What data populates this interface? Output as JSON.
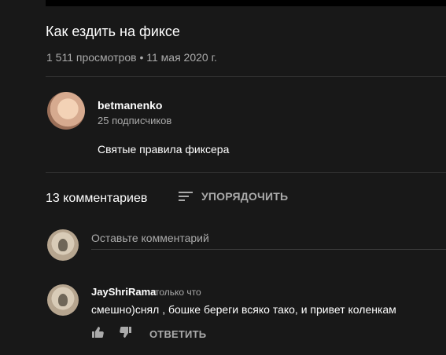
{
  "video": {
    "title": "Как ездить на фиксе",
    "meta": "1 511 просмотров • 11 мая 2020 г."
  },
  "channel": {
    "name": "betmanenko",
    "subscribers": "25 подписчиков",
    "description": "Святые правила фиксера"
  },
  "comments": {
    "count_label": "13 комментариев",
    "sort_label": "УПОРЯДОЧИТЬ",
    "input_placeholder": "Оставьте комментарий",
    "items": [
      {
        "author": "JayShriRama",
        "time": "только что",
        "text": "смешно)снял , бошке береги всяко тако, и привет коленкам",
        "reply_label": "ОТВЕТИТЬ"
      }
    ]
  }
}
